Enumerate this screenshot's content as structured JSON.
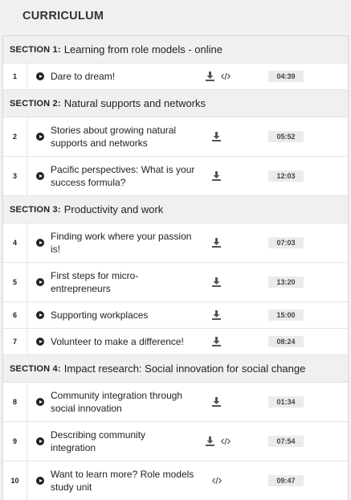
{
  "page_title": "CURRICULUM",
  "colors": {
    "background": "#f0f0f0",
    "section_bg": "#f0f0f0",
    "row_bg": "#ffffff",
    "duration_bg": "#ebebeb",
    "text": "#222222"
  },
  "sections": [
    {
      "number_label": "SECTION 1:",
      "title": "Learning from role models - online"
    },
    {
      "number_label": "SECTION 2:",
      "title": "Natural supports and networks"
    },
    {
      "number_label": "SECTION 3:",
      "title": "Productivity and work"
    },
    {
      "number_label": "SECTION 4:",
      "title": "Impact research: Social innovation for social change"
    }
  ],
  "lessons": [
    {
      "num": "1",
      "title": "Dare to dream!",
      "duration": "04:39",
      "icons": [
        "play-icon",
        "download-icon",
        "embed-icon"
      ]
    },
    {
      "num": "2",
      "title": "Stories about growing natural supports and networks",
      "duration": "05:52",
      "icons": [
        "play-icon",
        "download-icon"
      ]
    },
    {
      "num": "3",
      "title": "Pacific perspectives: What is your success formula?",
      "duration": "12:03",
      "icons": [
        "play-icon",
        "download-icon"
      ]
    },
    {
      "num": "4",
      "title": "Finding work where your passion is!",
      "duration": "07:03",
      "icons": [
        "play-icon",
        "download-icon"
      ]
    },
    {
      "num": "5",
      "title": "First steps for micro-entrepreneurs",
      "duration": "13:20",
      "icons": [
        "play-icon",
        "download-icon"
      ]
    },
    {
      "num": "6",
      "title": "Supporting workplaces",
      "duration": "15:00",
      "icons": [
        "play-icon",
        "download-icon"
      ]
    },
    {
      "num": "7",
      "title": "Volunteer to make a difference!",
      "duration": "08:24",
      "icons": [
        "play-icon",
        "download-icon"
      ]
    },
    {
      "num": "8",
      "title": "Community integration through social innovation",
      "duration": "01:34",
      "icons": [
        "play-icon",
        "download-icon"
      ]
    },
    {
      "num": "9",
      "title": "Describing community integration",
      "duration": "07:54",
      "icons": [
        "play-icon",
        "download-icon",
        "embed-icon"
      ]
    },
    {
      "num": "10",
      "title": "Want to learn more? Role models study unit",
      "duration": "09:47",
      "icons": [
        "play-icon",
        "embed-icon"
      ]
    }
  ]
}
